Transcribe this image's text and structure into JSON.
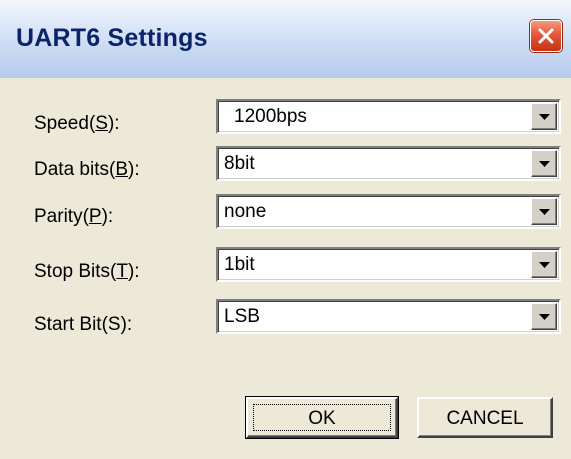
{
  "window": {
    "title": "UART6 Settings"
  },
  "fields": [
    {
      "label_pre": "Speed(",
      "label_key": "S",
      "label_post": "):",
      "value": "1200bps"
    },
    {
      "label_pre": "Data bits(",
      "label_key": "B",
      "label_post": "):",
      "value": "8bit"
    },
    {
      "label_pre": "Parity(",
      "label_key": "P",
      "label_post": "):",
      "value": "none"
    },
    {
      "label_pre": "Stop Bits(",
      "label_key": "T",
      "label_post": "):",
      "value": "1bit"
    },
    {
      "label_pre": "Start Bit(S):",
      "label_key": "",
      "label_post": "",
      "value": "LSB"
    }
  ],
  "buttons": {
    "ok": "OK",
    "cancel": "CANCEL"
  },
  "colors": {
    "title_text": "#0a246a",
    "dialog_bg": "#ece9d8",
    "close_button": "#e4573a"
  },
  "icons": {
    "close": "close-icon",
    "dropdown": "chevron-down-icon"
  }
}
